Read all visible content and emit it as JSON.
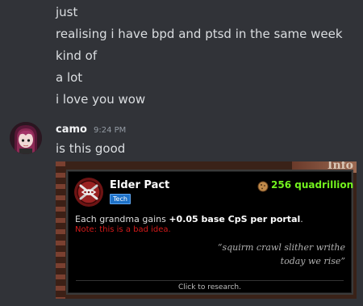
{
  "chat": {
    "previous_lines": [
      "just",
      "realising i have bpd and ptsd in the same week",
      "kind of",
      "a lot",
      "i love you wow"
    ],
    "message": {
      "username": "camo",
      "timestamp": "9:24 PM",
      "text": "is this good"
    }
  },
  "attachment": {
    "background_label": "Info",
    "tooltip": {
      "title": "Elder Pact",
      "tag": "Tech",
      "price": "256 quadrillion",
      "desc_prefix": "Each grandma gains ",
      "desc_bold": "+0.05 base CpS per portal",
      "desc_suffix": ".",
      "note": "Note: this is a bad idea.",
      "quote_line1": "“squirm crawl slither writhe",
      "quote_line2": "today we rise”",
      "action": "Click to research."
    }
  },
  "colors": {
    "background": "#313338",
    "price": "#73f21e",
    "note": "#d41a1a",
    "tag": "#1e72c9"
  },
  "icons": {
    "avatar": "avatar-image",
    "upgrade": "elder-pact-icon",
    "price": "cookie-icon"
  }
}
